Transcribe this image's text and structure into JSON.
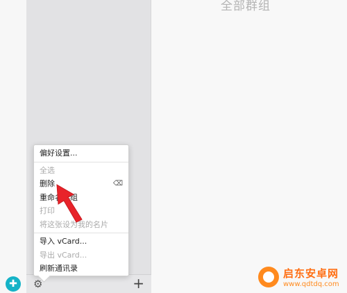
{
  "main": {
    "title": "全部群组"
  },
  "menu": {
    "items": [
      {
        "label": "偏好设置...",
        "disabled": false
      },
      {
        "label": "全选",
        "disabled": true
      },
      {
        "label": "删除",
        "disabled": false,
        "shortcut_icon": "delete-key-icon"
      },
      {
        "label": "重命名群组",
        "disabled": false
      },
      {
        "label": "打印",
        "disabled": true
      },
      {
        "label": "将这张设为我的名片",
        "disabled": true
      },
      {
        "label": "导入 vCard...",
        "disabled": false
      },
      {
        "label": "导出 vCard...",
        "disabled": true
      },
      {
        "label": "刷新通讯录",
        "disabled": false
      }
    ]
  },
  "bottom_bar": {
    "gear_icon": "gear-icon",
    "add_icon": "plus-icon",
    "add_symbol": "+"
  },
  "watermark": {
    "title": "启东安卓网",
    "url": "www.qdtdq.com"
  },
  "colors": {
    "arrow": "#e8232a",
    "sidebar": "#e2e2e4",
    "app_logo": "#15b3c7",
    "watermark": "#ff6f14"
  }
}
